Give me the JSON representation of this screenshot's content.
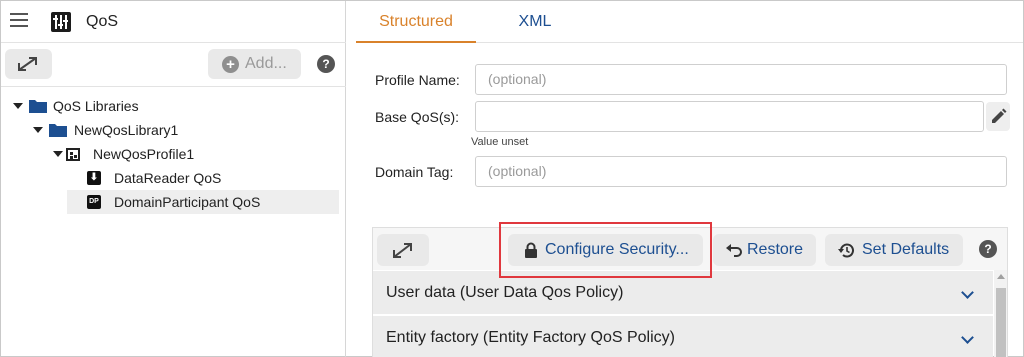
{
  "app": {
    "title": "QoS"
  },
  "left_toolbar": {
    "add_label": "Add...",
    "help": "?"
  },
  "tree": [
    {
      "label": "QoS Libraries",
      "icon": "folder-icon"
    },
    {
      "label": "NewQosLibrary1",
      "icon": "folder-icon"
    },
    {
      "label": "NewQosProfile1",
      "icon": "profile-icon"
    },
    {
      "label": "DataReader QoS",
      "icon": "datareader-icon"
    },
    {
      "label": "DomainParticipant QoS",
      "icon": "domainparticipant-icon",
      "icon_text": "DP",
      "selected": true
    }
  ],
  "tabs": {
    "structured": "Structured",
    "xml": "XML"
  },
  "form": {
    "profile_name_label": "Profile Name:",
    "profile_name_placeholder": "(optional)",
    "base_qos_label": "Base QoS(s):",
    "base_qos_hint": "Value unset",
    "domain_tag_label": "Domain Tag:",
    "domain_tag_placeholder": "(optional)"
  },
  "policy_toolbar": {
    "configure_security": "Configure Security...",
    "restore": "Restore",
    "set_defaults": "Set Defaults",
    "help": "?"
  },
  "policies": [
    {
      "label": "User data (User Data Qos Policy)"
    },
    {
      "label": "Entity factory (Entity Factory QoS Policy)"
    }
  ],
  "colors": {
    "accent_orange": "#d9822b",
    "accent_blue": "#1d4f91",
    "highlight_red": "#e0383e"
  }
}
